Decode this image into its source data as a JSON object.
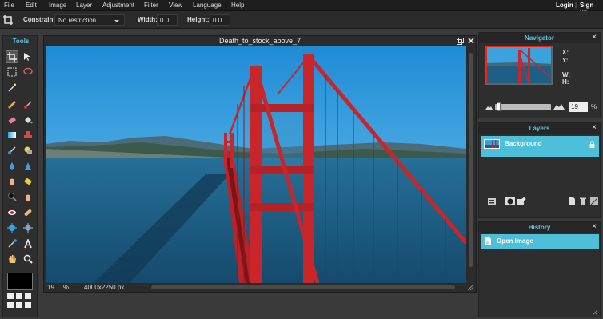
{
  "menu": {
    "items": [
      "File",
      "Edit",
      "Image",
      "Layer",
      "Adjustment",
      "Filter",
      "View",
      "Language",
      "Help"
    ],
    "login": "Login",
    "separator": "|",
    "signup": "Sign up"
  },
  "options": {
    "constraint_label": "Constraint:",
    "constraint_value": "No restriction",
    "width_label": "Width:",
    "width_value": "0.0",
    "height_label": "Height:",
    "height_value": "0.0"
  },
  "tools": {
    "title": "Tools",
    "foreground_color": "#000000"
  },
  "document": {
    "title": "Death_to_stock_above_7",
    "zoom": "19",
    "zoom_unit": "%",
    "dimensions": "4000x2250 px"
  },
  "navigator": {
    "title": "Navigator",
    "x_label": "X:",
    "y_label": "Y:",
    "w_label": "W:",
    "h_label": "H:",
    "zoom_value": "19",
    "zoom_unit": "%",
    "zoom_level": 0.19
  },
  "layers": {
    "title": "Layers",
    "items": [
      {
        "name": "Background",
        "locked": true
      }
    ]
  },
  "history": {
    "title": "History",
    "items": [
      {
        "label": "Open Image"
      }
    ]
  },
  "colors": {
    "accent": "#5ec7e8",
    "selection": "#4dbfd9",
    "bridge": "#c8262a",
    "sky": "#3aa3dd",
    "water": "#1d5f86"
  }
}
